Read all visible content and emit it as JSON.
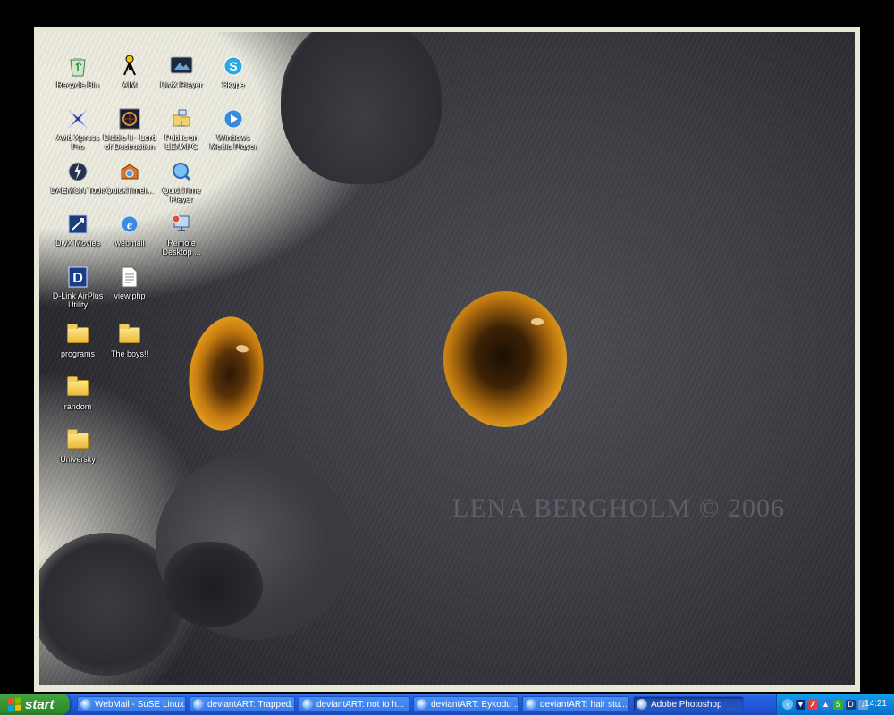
{
  "wallpaper": {
    "watermark": "LENA BERGHOLM © 2006"
  },
  "desktop_icons": [
    {
      "label": "Recycle Bin",
      "icon": "recycle-bin-icon"
    },
    {
      "label": "AIM",
      "icon": "aim-icon"
    },
    {
      "label": "DivX Player",
      "icon": "divx-player-icon"
    },
    {
      "label": "Skype",
      "icon": "skype-icon"
    },
    {
      "label": "Avid Xpress Pro",
      "icon": "avid-icon"
    },
    {
      "label": "Diablo II - Lord of Destruction",
      "icon": "diablo-icon"
    },
    {
      "label": "Public on LENAPC",
      "icon": "network-folder-icon"
    },
    {
      "label": "Windows Media Player",
      "icon": "media-player-icon"
    },
    {
      "label": "DAEMON Tools",
      "icon": "daemon-tools-icon"
    },
    {
      "label": "QuickTimeI...",
      "icon": "quicktime-installer-icon"
    },
    {
      "label": "QuickTime Player",
      "icon": "quicktime-icon"
    },
    {
      "label": "DivX Movies",
      "icon": "divx-movies-icon"
    },
    {
      "label": "webmail",
      "icon": "ie-shortcut-icon"
    },
    {
      "label": "Remote Desktop ...",
      "icon": "remote-desktop-icon"
    },
    {
      "label": "D-Link AirPlus Utility",
      "icon": "dlink-icon"
    },
    {
      "label": "view.php",
      "icon": "php-file-icon"
    },
    {
      "label": "programs",
      "icon": "folder-icon"
    },
    {
      "label": "The boys!!",
      "icon": "folder-icon"
    },
    {
      "label": "random",
      "icon": "folder-icon"
    },
    {
      "label": "University",
      "icon": "folder-icon"
    }
  ],
  "taskbar": {
    "start_label": "start",
    "tasks": [
      {
        "label": "WebMail - SuSE Linux..."
      },
      {
        "label": "deviantART: Trapped..."
      },
      {
        "label": "deviantART: not to h..."
      },
      {
        "label": "deviantART: Eykodu ..."
      },
      {
        "label": "deviantART: hair stu..."
      },
      {
        "label": "Adobe Photoshop",
        "active": true
      }
    ],
    "clock": "14:21"
  },
  "colors": {
    "taskbar_blue": "#2157d6",
    "start_green": "#3a9a3a",
    "tray_blue": "#0c7fd8",
    "eye_amber": "#e7a01f"
  }
}
